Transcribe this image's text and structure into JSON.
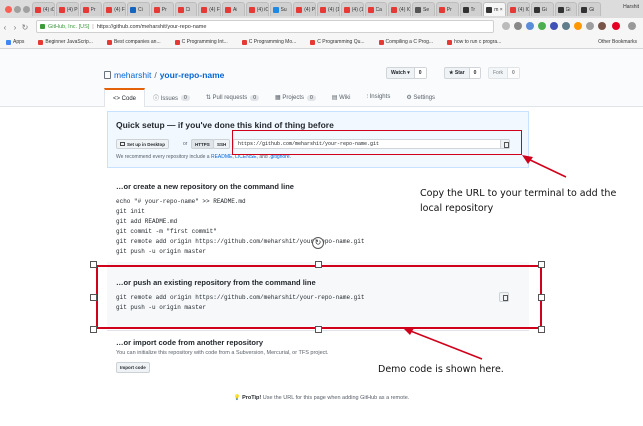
{
  "browser": {
    "tabs": [
      {
        "label": "(4) ιC",
        "color": "#e53935"
      },
      {
        "label": "(4) Pr",
        "color": "#e53935"
      },
      {
        "label": "Pr",
        "color": "#e53935"
      },
      {
        "label": "(4) F",
        "color": "#e53935"
      },
      {
        "label": "Ci",
        "color": "#1565c0"
      },
      {
        "label": "Pr",
        "color": "#e53935"
      },
      {
        "label": "Ci",
        "color": "#e53935"
      },
      {
        "label": "(4) Fi",
        "color": "#e53935"
      },
      {
        "label": "Ai",
        "color": "#e53935"
      },
      {
        "label": "(4) iC",
        "color": "#e53935"
      },
      {
        "label": "Su",
        "color": "#1e88e5"
      },
      {
        "label": "(4) Pr",
        "color": "#e53935"
      },
      {
        "label": "(4) (1",
        "color": "#e53935"
      },
      {
        "label": "(4) (1",
        "color": "#e53935"
      },
      {
        "label": "Ca",
        "color": "#e53935"
      },
      {
        "label": "(4) IC",
        "color": "#e53935"
      },
      {
        "label": "Se",
        "color": "#555555"
      },
      {
        "label": "Pr",
        "color": "#e53935"
      },
      {
        "label": "Tr",
        "color": "#333333"
      },
      {
        "label": "m ×",
        "color": "#333333",
        "active": true
      },
      {
        "label": "(4) IC",
        "color": "#e53935"
      },
      {
        "label": "Gi",
        "color": "#333333"
      },
      {
        "label": "Gi",
        "color": "#333333"
      },
      {
        "label": "Gi",
        "color": "#333333"
      }
    ],
    "profile": "Harshit",
    "address_org": "GitHub, Inc. [US]",
    "address_url": "https://github.com/meharshit/your-repo-name",
    "bookmarks": [
      "Apps",
      "Beginner JavaScrip...",
      "Best companies an...",
      "C Programming Int...",
      "C Programming Mo...",
      "C Programming Qu...",
      "Compiling a C Prog...",
      "how to run c progra..."
    ],
    "other_bookmarks": "Other Bookmarks"
  },
  "repo": {
    "owner": "meharshit",
    "name": "your-repo-name",
    "watch_label": "Watch ▾",
    "watch_count": "0",
    "star_label": "★ Star",
    "star_count": "0",
    "fork_label": "Fork",
    "fork_count": "0",
    "nav": [
      {
        "label": "<> Code"
      },
      {
        "label": "ⓘ Issues",
        "badge": "0"
      },
      {
        "label": "⇅ Pull requests",
        "badge": "0"
      },
      {
        "label": "▦ Projects",
        "badge": "0"
      },
      {
        "label": "▤ Wiki"
      },
      {
        "label": "⫶ Insights"
      },
      {
        "label": "⚙ Settings"
      }
    ]
  },
  "quick_setup": {
    "title": "Quick setup — if you've done this kind of thing before",
    "desktop_button": "Set up in Desktop",
    "or": "or",
    "https_button": "HTTPS",
    "ssh_button": "SSH",
    "url": "https://github.com/meharshit/your-repo-name.git",
    "recommend_prefix": "We recommend every repository include a ",
    "readme": "README",
    "license": "LICENSE",
    "gitignore": ".gitignore"
  },
  "create_section": {
    "title": "…or create a new repository on the command line",
    "code": "echo \"# your-repo-name\" >> README.md\ngit init\ngit add README.md\ngit commit -m \"first commit\"\ngit remote add origin https://github.com/meharshit/your-repo-name.git\ngit push -u origin master"
  },
  "push_section": {
    "title": "…or push an existing repository from the command line",
    "code": "git remote add origin https://github.com/meharshit/your-repo-name.git\ngit push -u origin master"
  },
  "import_section": {
    "title": "…or import code from another repository",
    "desc": "You can initialize this repository with code from a Subversion, Mercurial, or TFS project.",
    "button": "Import code"
  },
  "protip": {
    "label": "ProTip!",
    "text": " Use the URL for this page when adding GitHub as a remote."
  },
  "annotations": {
    "copy_url": "Copy the URL to your terminal to add the local repository",
    "demo_code": "Demo code is shown here."
  },
  "colors": {
    "annotation_red": "#d0021b",
    "accent_blue": "#0366d6"
  }
}
